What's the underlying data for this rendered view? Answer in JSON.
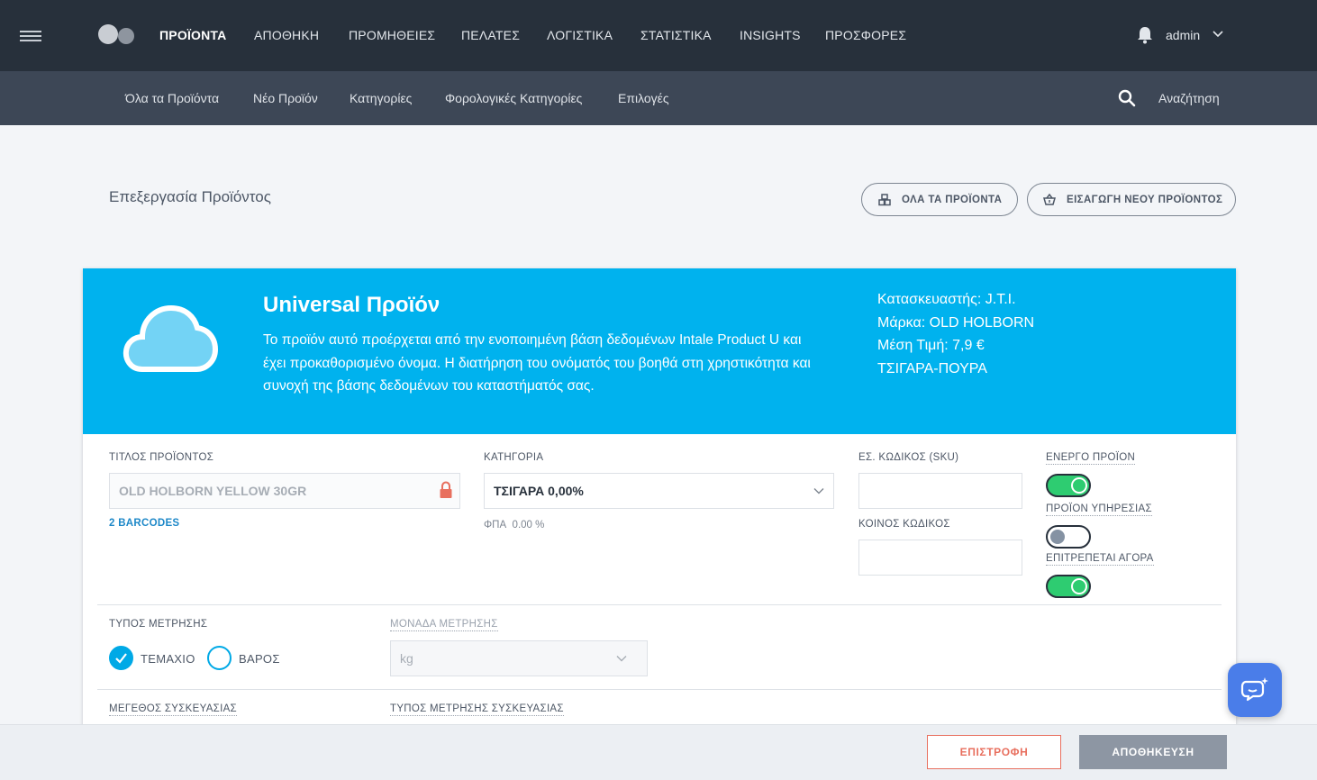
{
  "topnav": {
    "items": [
      "ΠΡΟΪΟΝΤΑ",
      "ΑΠΟΘΗΚΗ",
      "ΠΡΟΜΗΘΕΙΕΣ",
      "ΠΕΛΑΤΕΣ",
      "ΛΟΓΙΣΤΙΚΑ",
      "ΣΤΑΤΙΣΤΙΚΑ",
      "INSIGHTS",
      "ΠΡΟΣΦΟΡΕΣ"
    ],
    "active": "ΠΡΟΪΟΝΤΑ",
    "user": "admin"
  },
  "subnav": {
    "items": [
      "Όλα τα Προϊόντα",
      "Νέο Προϊόν",
      "Κατηγορίες",
      "Φορολογικές Κατηγορίες",
      "Επιλογές"
    ],
    "search_label": "Αναζήτηση"
  },
  "page": {
    "title": "Επεξεργασία Προϊόντος",
    "all_products_button": "ΟΛΑ ΤΑ ΠΡΟΪΟΝΤΑ",
    "new_product_button": "ΕΙΣΑΓΩΓΗ ΝΕΟΥ ΠΡΟΪΟΝΤΟΣ"
  },
  "hero": {
    "title": "Universal Προϊόν",
    "description": "Το προϊόν αυτό προέρχεται από την ενοποιημένη βάση δεδομένων Intale Product U και έχει προκαθορισμένο όνομα. Η διατήρηση του ονόματός του βοηθά στη χρηστικότητα και συνοχή της βάσης δεδομένων του καταστήματός σας.",
    "manufacturer": "Κατασκευαστής: J.T.I.",
    "brand": "Μάρκα: OLD HOLBORN",
    "avg_price": "Μέση Τιμή: 7,9 €",
    "category": "ΤΣΙΓΑΡΑ-ΠΟΥΡΑ"
  },
  "form": {
    "title_label": "ΤΙΤΛΟΣ ΠΡΟΪΟΝΤΟΣ",
    "title_value": "OLD HOLBORN YELLOW 30GR",
    "barcodes_link": "2 BARCODES",
    "category_label": "ΚΑΤΗΓΟΡΙΑ",
    "category_value": "ΤΣΙΓΑΡΑ 0,00%",
    "vat_label": "ΦΠΑ",
    "vat_value": "0.00 %",
    "sku_label": "ΕΣ. ΚΩΔΙΚΟΣ (SKU)",
    "sku_value": "",
    "common_code_label": "ΚΟΙΝΟΣ ΚΩΔΙΚΟΣ",
    "common_code_value": "",
    "active_label": "ΕΝΕΡΓΟ ΠΡΟΪΟΝ",
    "active": true,
    "service_label": "ΠΡΟΪΟΝ ΥΠΗΡΕΣΙΑΣ",
    "service": false,
    "purchase_label": "ΕΠΙΤΡΕΠΕΤΑΙ ΑΓΟΡΑ",
    "purchase": true,
    "measure_type_label": "ΤΥΠΟΣ ΜΕΤΡΗΣΗΣ",
    "measure_options": [
      "ΤΕΜΑΧΙΟ",
      "ΒΑΡΟΣ"
    ],
    "measure_selected": "ΤΕΜΑΧΙΟ",
    "unit_label": "ΜΟΝΑΔΑ ΜΕΤΡΗΣΗΣ",
    "unit_value": "kg",
    "pack_size_label": "ΜΕΓΕΘΟΣ ΣΥΣΚΕΥΑΣΙΑΣ",
    "pack_measure_label": "ΤΥΠΟΣ ΜΕΤΡΗΣΗΣ ΣΥΣΚΕΥΑΣΙΑΣ"
  },
  "footer": {
    "back_button": "ΕΠΙΣΤΡΟΦΗ",
    "save_button": "ΑΠΟΘΗΚΕΥΣΗ"
  },
  "colors": {
    "topbar": "#27303b",
    "subbar": "#3d4756",
    "hero": "#00b2ee",
    "toggle_on": "#2ecc71",
    "back_button": "#e8705f",
    "chat": "#4a7de9"
  }
}
